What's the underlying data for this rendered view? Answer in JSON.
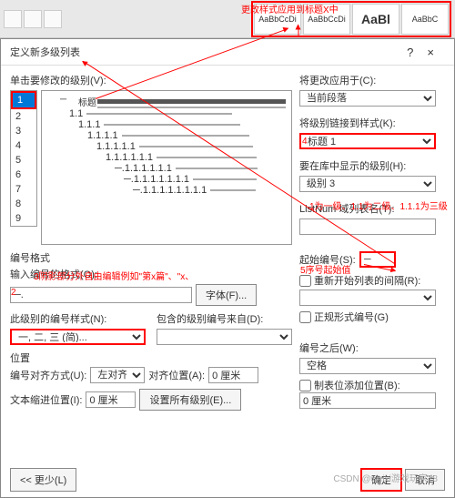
{
  "toolbar": {
    "style_gallery": [
      "AaBbCcDi",
      "AaBbCcDi",
      "AaBl",
      "AaBbC"
    ]
  },
  "dialog": {
    "title": "定义新多级列表",
    "help": "?",
    "close": "×"
  },
  "left": {
    "click_level_label": "单击要修改的级别(V):",
    "levels": [
      "1",
      "2",
      "3",
      "4",
      "5",
      "6",
      "7",
      "8",
      "9"
    ],
    "preview_title": "标题",
    "number_format_section": "编号格式",
    "enter_format_label": "输入编号的格式(O):",
    "format_value": "─.",
    "font_btn": "字体(F)...",
    "style_label": "此级别的编号样式(N):",
    "style_value": "一, 二, 三 (简)...",
    "include_from_label": "包含的级别编号来自(D):",
    "position_section": "位置",
    "align_label": "编号对齐方式(U):",
    "align_value": "左对齐",
    "align_at_label": "对齐位置(A):",
    "align_at_value": "0 厘米",
    "indent_label": "文本缩进位置(I):",
    "indent_value": "0 厘米",
    "set_all_btn": "设置所有级别(E)...",
    "follow_label": "编号之后(W):",
    "follow_value": "空格",
    "tab_add_label": "制表位添加位置(B):",
    "tab_add_value": "0 厘米"
  },
  "right": {
    "apply_to_label": "将更改应用于(C):",
    "apply_to_value": "当前段落",
    "link_style_label": "将级别链接到样式(K):",
    "link_style_value": "标题 1",
    "show_in_gallery_label": "要在库中显示的级别(H):",
    "show_in_gallery_value": "级别 3",
    "listnum_label": "ListNum 域列表名(T):",
    "start_at_label": "起始编号(S):",
    "start_at_value": "─",
    "restart_label": "重新开始列表的间隔(R):",
    "legal_label": "正规形式编号(G)"
  },
  "footer": {
    "less": "<< 更少(L)",
    "ok": "确定",
    "cancel": "取消"
  },
  "annotations": {
    "top": "更改样式应用到标题X中",
    "a3": "3阴影部分外自由编辑例如\"第x篇\"、\"x、",
    "a2": "2",
    "a4": "4",
    "a5": "5序号起始值",
    "hint": "1为一级、1.1为二级、1.1.1为三级"
  },
  "preview": {
    "items": [
      "─",
      "1.1",
      "1.1.1",
      "1.1.1.1",
      "1.1.1.1.1",
      "1.1.1.1.1.1",
      "─.1.1.1.1.1.1",
      "─.1.1.1.1.1.1.1",
      "─.1.1.1.1.1.1.1.1"
    ]
  },
  "watermark": "CSDN @weixi游戏玩家78"
}
